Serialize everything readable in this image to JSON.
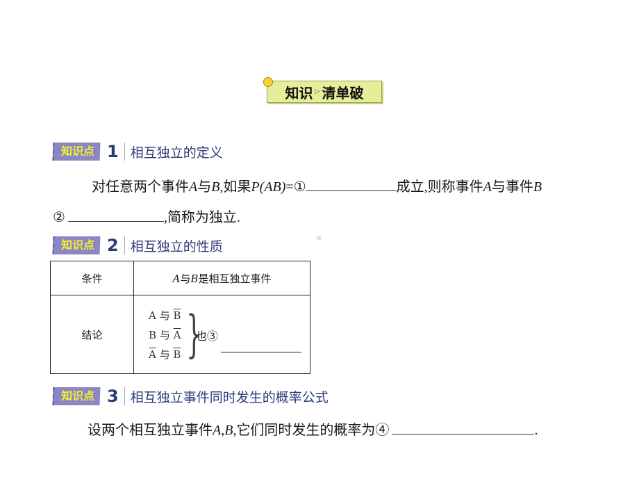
{
  "banner": {
    "left": "知识",
    "right": "清单破"
  },
  "sections": [
    {
      "tag": "知识点",
      "number": "1",
      "title": "相互独立的定义"
    },
    {
      "tag": "知识点",
      "number": "2",
      "title": "相互独立的性质"
    },
    {
      "tag": "知识点",
      "number": "3",
      "title": "相互独立事件同时发生的概率公式"
    }
  ],
  "def": {
    "line1_a": "对任意两个事件",
    "A": "A",
    "yu": "与",
    "B": "B",
    "line1_b": ",如果",
    "P": "P",
    "AB": "(AB)",
    "eq": "=①",
    "line1_c": "成立,则称事件",
    "line1_d": "与事件",
    "circle2": "②",
    "line2_end": ",简称为独立."
  },
  "table": {
    "cond_label": "条件",
    "cond_value_A": "A",
    "cond_value_yu": "与",
    "cond_value_B": "B",
    "cond_value_rest": "是相互独立事件",
    "concl_label": "结论",
    "pairs": [
      {
        "left": "A",
        "right": "B",
        "left_bar": false,
        "right_bar": true
      },
      {
        "left": "B",
        "right": "A",
        "left_bar": false,
        "right_bar": true
      },
      {
        "left": "A",
        "right": "B",
        "left_bar": true,
        "right_bar": true
      }
    ],
    "pair_sep": "与",
    "also": "也③"
  },
  "formula": {
    "text_a": "设两个相互独立事件",
    "A": "A",
    "comma": ",",
    "B": "B",
    "text_b": ",它们同时发生的概率为④",
    "end": "."
  }
}
